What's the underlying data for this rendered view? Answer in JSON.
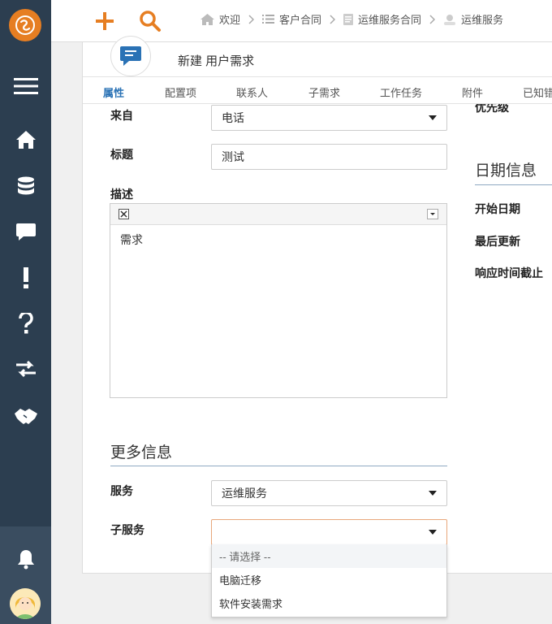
{
  "breadcrumb": [
    {
      "label": "欢迎",
      "icon": "home-icon"
    },
    {
      "label": "客户合同",
      "icon": "list-icon"
    },
    {
      "label": "运维服务合同",
      "icon": "document-icon"
    },
    {
      "label": "运维服务",
      "icon": "service-icon"
    }
  ],
  "ticket": {
    "title": "新建 用户需求"
  },
  "tabs": [
    "属性",
    "配置项",
    "联系人",
    "子需求",
    "工作任务",
    "附件",
    "已知错"
  ],
  "form": {
    "origin_label": "来自",
    "origin_value": "电话",
    "title_label": "标题",
    "title_value": "测试",
    "description_label": "描述",
    "description_value": "需求",
    "more_info_title": "更多信息",
    "service_label": "服务",
    "service_value": "运维服务",
    "subservice_label": "子服务",
    "subservice_value": ""
  },
  "right": {
    "priority_label": "优先级",
    "dates_title": "日期信息",
    "start_date_label": "开始日期",
    "last_update_label": "最后更新",
    "response_deadline_label": "响应时间截止"
  },
  "dropdown_options": [
    "-- 请选择 --",
    "电脑迁移",
    "软件安装需求"
  ],
  "colors": {
    "sidebar": "#2c3e50",
    "accent": "#e67e22",
    "link": "#2a72b5"
  }
}
